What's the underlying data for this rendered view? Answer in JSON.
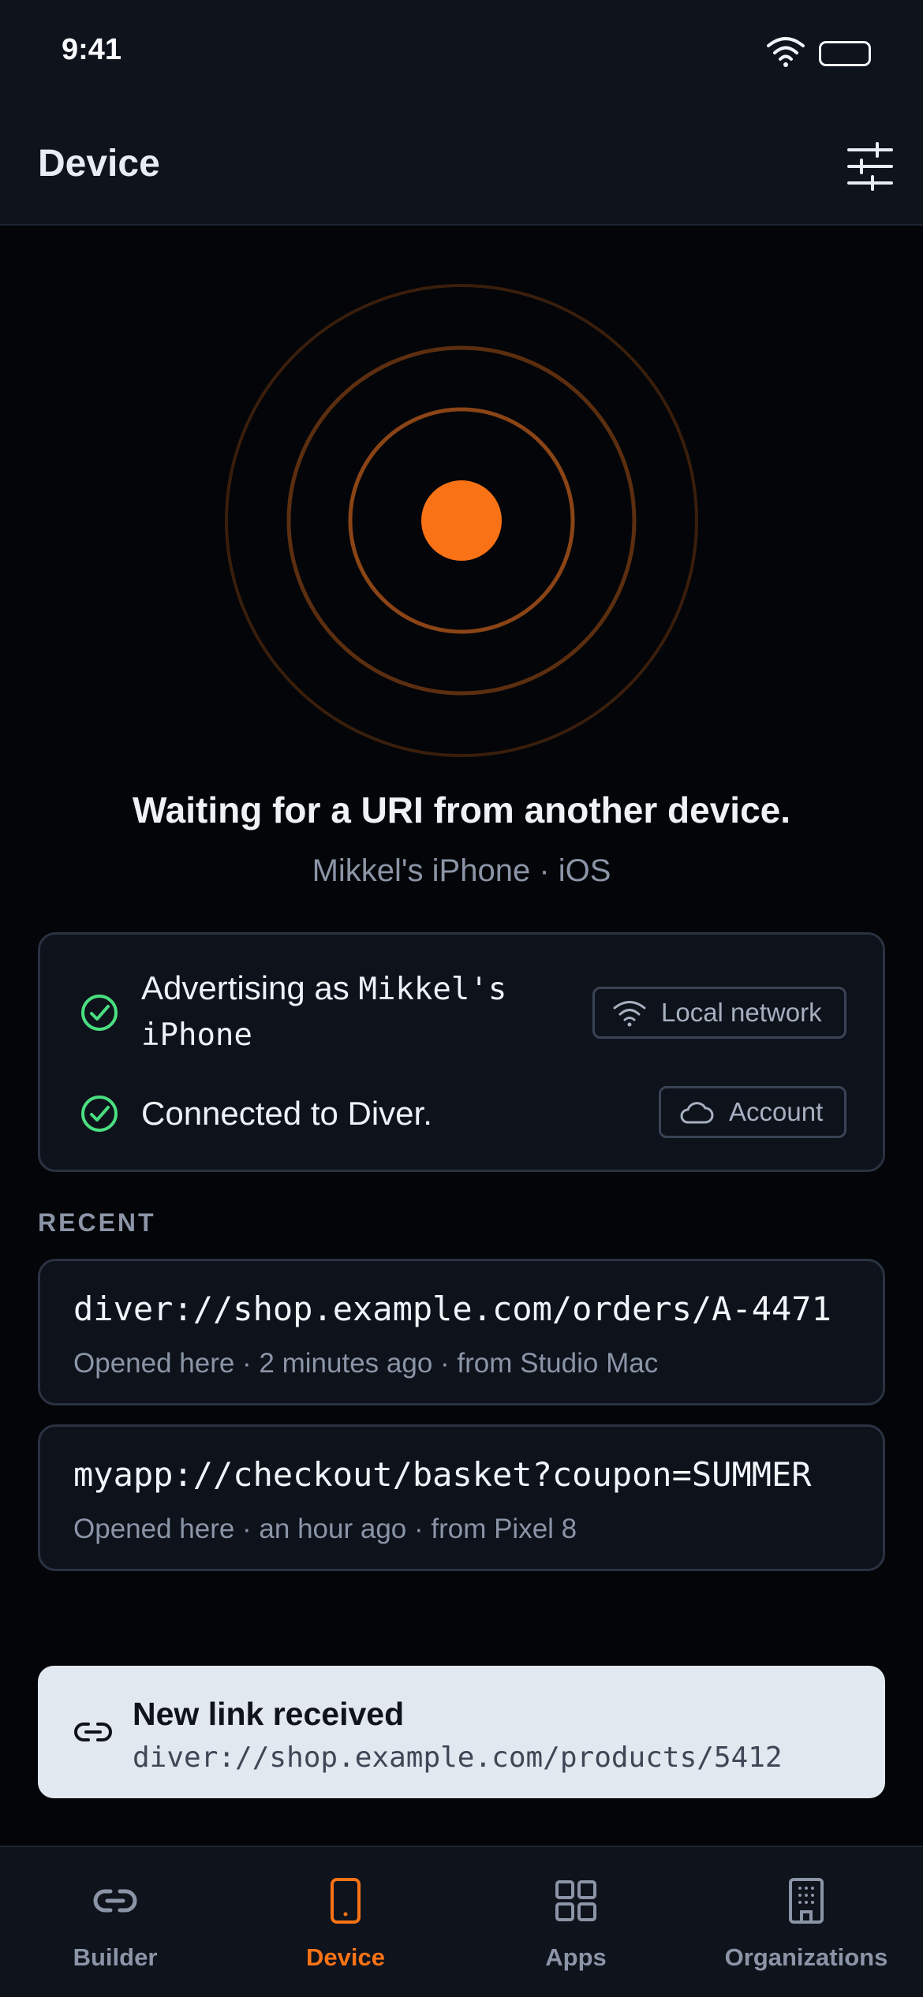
{
  "status_bar": {
    "time": "9:41"
  },
  "header": {
    "title": "Device"
  },
  "hero": {
    "title": "Waiting for a URI from another device.",
    "subtitle": "Mikkel's iPhone · iOS"
  },
  "status_card": {
    "advertising_prefix": "Advertising as ",
    "advertising_name": "Mikkel's iPhone",
    "local_network_label": "Local network",
    "connected_text": "Connected to Diver.",
    "account_label": "Account"
  },
  "recent": {
    "label": "RECENT",
    "items": [
      {
        "uri": "diver://shop.example.com/orders/A-4471",
        "meta": "Opened here · 2 minutes ago · from Studio Mac"
      },
      {
        "uri": "myapp://checkout/basket?coupon=SUMMER",
        "meta": "Opened here · an hour ago · from Pixel 8"
      }
    ]
  },
  "toast": {
    "title": "New link received",
    "uri": "diver://shop.example.com/products/5412"
  },
  "tabs": [
    {
      "label": "Builder",
      "icon": "link-icon",
      "active": false
    },
    {
      "label": "Device",
      "icon": "phone-icon",
      "active": true
    },
    {
      "label": "Apps",
      "icon": "grid-icon",
      "active": false
    },
    {
      "label": "Organizations",
      "icon": "building-icon",
      "active": false
    }
  ],
  "colors": {
    "accent": "#f97316",
    "success": "#4ade80",
    "background": "#030508",
    "surface": "#0e121b"
  }
}
